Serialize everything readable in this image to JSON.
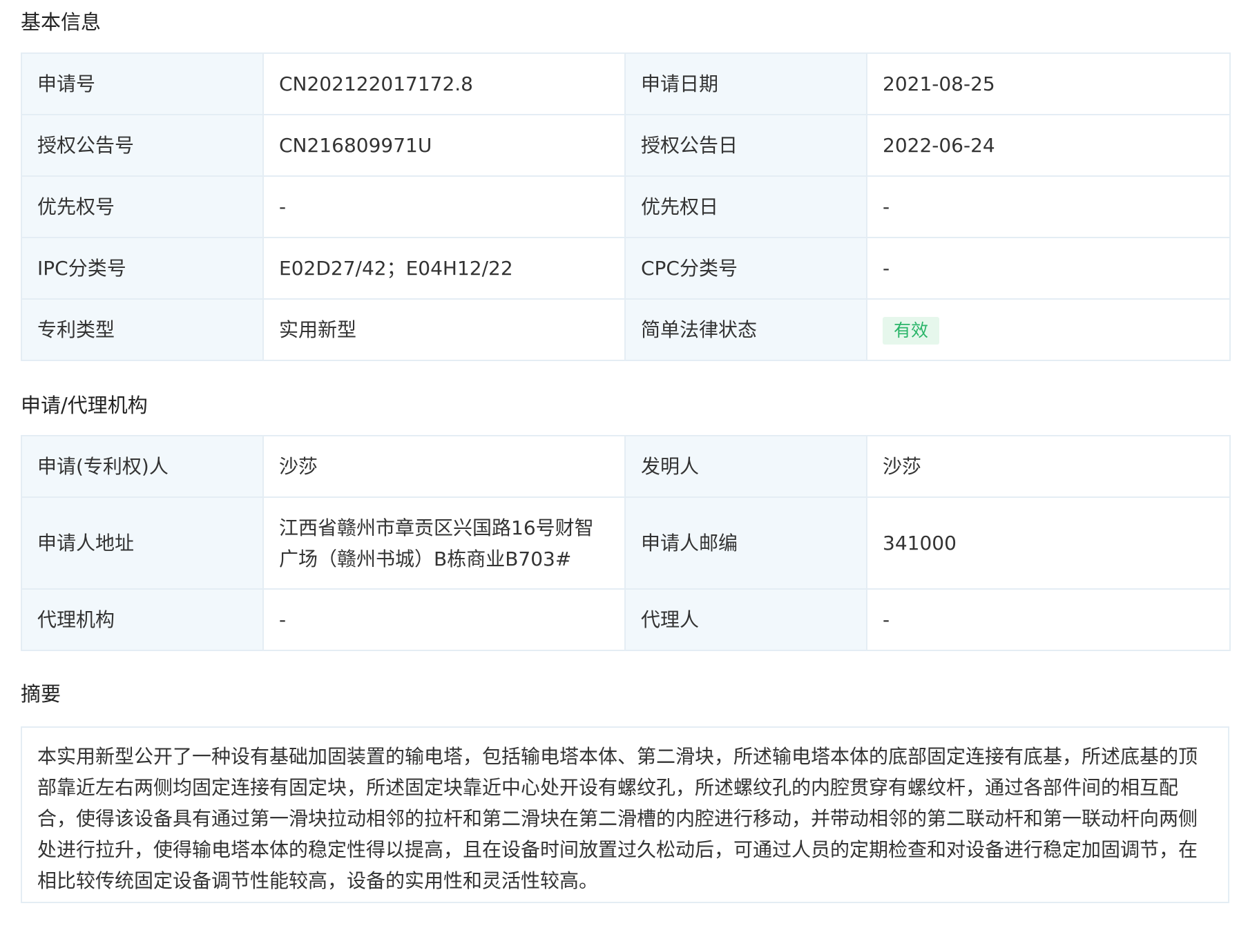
{
  "basic_info": {
    "title": "基本信息",
    "rows": [
      [
        {
          "label": "申请号",
          "value": "CN202122017172.8"
        },
        {
          "label": "申请日期",
          "value": "2021-08-25"
        }
      ],
      [
        {
          "label": "授权公告号",
          "value": "CN216809971U"
        },
        {
          "label": "授权公告日",
          "value": "2022-06-24"
        }
      ],
      [
        {
          "label": "优先权号",
          "value": "-"
        },
        {
          "label": "优先权日",
          "value": "-"
        }
      ],
      [
        {
          "label": "IPC分类号",
          "value": "E02D27/42；E04H12/22"
        },
        {
          "label": "CPC分类号",
          "value": "-"
        }
      ],
      [
        {
          "label": "专利类型",
          "value": "实用新型"
        },
        {
          "label": "简单法律状态",
          "value": "有效"
        }
      ]
    ]
  },
  "agency": {
    "title": "申请/代理机构",
    "rows": [
      [
        {
          "label": "申请(专利权)人",
          "value": "沙莎"
        },
        {
          "label": "发明人",
          "value": "沙莎"
        }
      ],
      [
        {
          "label": "申请人地址",
          "value": "江西省赣州市章贡区兴国路16号财智广场（赣州书城）B栋商业B703#"
        },
        {
          "label": "申请人邮编",
          "value": "341000"
        }
      ],
      [
        {
          "label": "代理机构",
          "value": "-"
        },
        {
          "label": "代理人",
          "value": "-"
        }
      ]
    ]
  },
  "abstract": {
    "title": "摘要",
    "text": "本实用新型公开了一种设有基础加固装置的输电塔，包括输电塔本体、第二滑块，所述输电塔本体的底部固定连接有底基，所述底基的顶部靠近左右两侧均固定连接有固定块，所述固定块靠近中心处开设有螺纹孔，所述螺纹孔的内腔贯穿有螺纹杆，通过各部件间的相互配合，使得该设备具有通过第一滑块拉动相邻的拉杆和第二滑块在第二滑槽的内腔进行移动，并带动相邻的第二联动杆和第一联动杆向两侧处进行拉升，使得输电塔本体的稳定性得以提高，且在设备时间放置过久松动后，可通过人员的定期检查和对设备进行稳定加固调节，在相比较传统固定设备调节性能较高，设备的实用性和灵活性较高。"
  },
  "colors": {
    "label_bg": "#f2f8fc",
    "border": "#e4edf4",
    "status_green": "#2bb569",
    "status_bg": "#e6f7ec"
  }
}
